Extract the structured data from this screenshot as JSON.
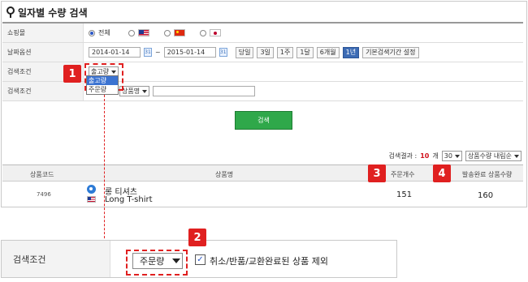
{
  "title": "일자별 수량 검색",
  "rows": {
    "mall": {
      "label": "쇼핑몰",
      "options": [
        {
          "label": "전체",
          "selected": true
        },
        {
          "label": "",
          "flag": "us-flag-icon"
        },
        {
          "label": "",
          "flag": "cn-flag-icon"
        },
        {
          "label": "",
          "flag": "jp-flag-icon"
        }
      ]
    },
    "period": {
      "label": "날짜옵션",
      "start": "2014-01-14",
      "sep": "~",
      "end": "2015-01-14",
      "quick": [
        "당일",
        "3일",
        "1주",
        "1달",
        "6개월",
        "1년"
      ],
      "active_quick": "1년",
      "default_btn": "기본검색기간 설정"
    },
    "cond1": {
      "label": "검색조건",
      "select_value": "출고량",
      "dropdown_options": [
        "출고량",
        "주문량"
      ],
      "highlighted": "출고량"
    },
    "cond2": {
      "label": "검색조건",
      "select_value": "상품명",
      "input_value": ""
    }
  },
  "search_button": "검색",
  "result": {
    "label": "검색결과 :",
    "count": "10",
    "unit": "개",
    "page_size": "30",
    "sort": "상품수량 내림순"
  },
  "table": {
    "headers": [
      "상품코드",
      "상품명",
      "주문개수",
      "발송완료 상품수량"
    ],
    "rows": [
      {
        "code": "7496",
        "name_ko": "롱 티셔츠",
        "name_en": "Long T-shirt",
        "ordered": "151",
        "shipped": "160"
      }
    ]
  },
  "zoom": {
    "label": "검색조건",
    "select_value": "주문량",
    "checkbox_label": "취소/반품/교환완료된 상품 제외",
    "checked": true
  },
  "badges": [
    "1",
    "2",
    "3",
    "4"
  ],
  "colors": {
    "accent_red": "#e02020",
    "search_green": "#2fa84a",
    "active_blue": "#3c6bb4"
  }
}
